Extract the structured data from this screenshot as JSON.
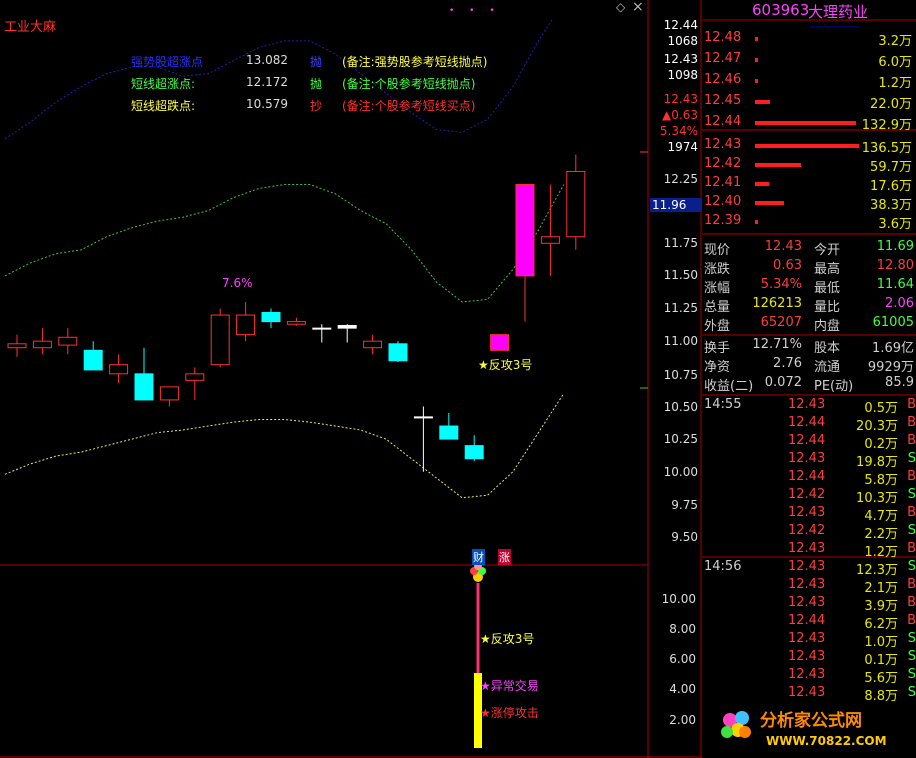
{
  "title": "工业大麻",
  "top_dots": "• • •",
  "diamond_icon": "◇",
  "close_icon": "×",
  "legend": [
    {
      "name": "强势股超涨点",
      "value": "13.082",
      "tag": "抛",
      "note": "(备注:强势股参考短线抛点)",
      "color": "#2a2aff",
      "tag_color": "#4040ff",
      "note_color": "#ffff40"
    },
    {
      "name": "短线超涨点:",
      "value": "12.172",
      "tag": "抛",
      "note": "(备注:个股参考短线抛点)",
      "color": "#40ff40",
      "tag_color": "#40ff40",
      "note_color": "#40ff40"
    },
    {
      "name": "短线超跌点:",
      "value": "10.579",
      "tag": "抄",
      "note": "(备注:个股参考短线买点)",
      "color": "#ffff40",
      "tag_color": "#ff3030",
      "note_color": "#ff3030"
    }
  ],
  "annotations": {
    "pct_label": "7.6%",
    "fangong_main": "★反攻3号",
    "cai_badge": "财",
    "zhang_badge": "涨",
    "fangong_sub": "★反攻3号",
    "yichang": "★异常交易",
    "zhangting": "★涨停攻击"
  },
  "price_axis": {
    "ticks": [
      "12.44",
      "1068",
      "12.43",
      "1098",
      "12.43",
      "▲0.63",
      "5.34%",
      "1974",
      "12.25",
      "11.96",
      "11.75",
      "11.50",
      "11.25",
      "11.00",
      "10.75",
      "10.50",
      "10.25",
      "10.00",
      "9.75",
      "9.50"
    ],
    "current": "11.96"
  },
  "sub_axis": [
    "10.00",
    "8.00",
    "6.00",
    "4.00",
    "2.00"
  ],
  "chart_data": {
    "type": "candlestick",
    "ylim": [
      9.4,
      12.55
    ],
    "candles": [
      {
        "o": 10.95,
        "h": 11.05,
        "l": 10.88,
        "c": 10.98,
        "dir": "up"
      },
      {
        "o": 10.95,
        "h": 11.1,
        "l": 10.9,
        "c": 11.0,
        "dir": "up"
      },
      {
        "o": 11.03,
        "h": 11.1,
        "l": 10.9,
        "c": 10.97,
        "dir": "up"
      },
      {
        "o": 10.93,
        "h": 11.0,
        "l": 10.78,
        "c": 10.78,
        "dir": "down"
      },
      {
        "o": 10.75,
        "h": 10.9,
        "l": 10.68,
        "c": 10.82,
        "dir": "up"
      },
      {
        "o": 10.75,
        "h": 10.95,
        "l": 10.55,
        "c": 10.55,
        "dir": "down"
      },
      {
        "o": 10.55,
        "h": 10.65,
        "l": 10.5,
        "c": 10.65,
        "dir": "up"
      },
      {
        "o": 10.7,
        "h": 10.8,
        "l": 10.55,
        "c": 10.75,
        "dir": "up"
      },
      {
        "o": 10.82,
        "h": 11.25,
        "l": 10.8,
        "c": 11.2,
        "dir": "up"
      },
      {
        "o": 11.05,
        "h": 11.3,
        "l": 11.0,
        "c": 11.2,
        "dir": "up"
      },
      {
        "o": 11.22,
        "h": 11.25,
        "l": 11.1,
        "c": 11.15,
        "dir": "down"
      },
      {
        "o": 11.15,
        "h": 11.18,
        "l": 11.12,
        "c": 11.13,
        "dir": "up"
      },
      {
        "o": 11.1,
        "h": 11.13,
        "l": 10.99,
        "c": 11.1,
        "dir": "flat"
      },
      {
        "o": 11.1,
        "h": 11.13,
        "l": 10.99,
        "c": 11.12,
        "dir": "flat"
      },
      {
        "o": 10.95,
        "h": 11.05,
        "l": 10.9,
        "c": 11.0,
        "dir": "up"
      },
      {
        "o": 10.98,
        "h": 11.0,
        "l": 10.84,
        "c": 10.85,
        "dir": "down"
      },
      {
        "o": 10.42,
        "h": 10.5,
        "l": 10.0,
        "c": 10.42,
        "dir": "flat"
      },
      {
        "o": 10.35,
        "h": 10.45,
        "l": 10.25,
        "c": 10.25,
        "dir": "down"
      },
      {
        "o": 10.2,
        "h": 10.28,
        "l": 10.08,
        "c": 10.1,
        "dir": "down"
      },
      {
        "o": 10.93,
        "h": 11.05,
        "l": 10.93,
        "c": 11.05,
        "dir": "magenta"
      },
      {
        "o": 11.5,
        "h": 12.2,
        "l": 11.15,
        "c": 12.2,
        "dir": "magenta"
      },
      {
        "o": 11.75,
        "h": 12.2,
        "l": 11.5,
        "c": 11.8,
        "dir": "up"
      },
      {
        "o": 11.8,
        "h": 12.43,
        "l": 11.7,
        "c": 12.3,
        "dir": "up"
      }
    ],
    "band_upper": [
      12.55,
      12.68,
      12.83,
      12.95,
      13.05,
      13.1,
      13.1,
      13.03,
      13.05,
      13.15,
      13.25,
      13.3,
      13.3,
      13.2,
      13.05,
      12.9,
      12.75,
      12.62,
      12.6,
      12.7,
      12.95,
      13.3,
      13.6
    ],
    "band_mid": [
      11.5,
      11.6,
      11.67,
      11.7,
      11.8,
      11.87,
      11.92,
      11.95,
      12.0,
      12.1,
      12.17,
      12.2,
      12.2,
      12.13,
      12.0,
      11.9,
      11.7,
      11.45,
      11.3,
      11.32,
      11.55,
      11.85,
      12.2
    ],
    "band_low": [
      9.98,
      10.06,
      10.12,
      10.15,
      10.2,
      10.25,
      10.3,
      10.32,
      10.35,
      10.38,
      10.4,
      10.4,
      10.38,
      10.35,
      10.32,
      10.25,
      10.1,
      9.95,
      9.8,
      9.82,
      10.0,
      10.3,
      10.6
    ],
    "sub": {
      "type": "bar",
      "ylim": [
        0,
        11.5
      ],
      "values": [
        5.0,
        11.0
      ]
    }
  },
  "quote": {
    "code": "603963",
    "name": "大理药业",
    "asks": [
      {
        "price": "12.48",
        "vol": "3.2万",
        "bar": 0.02
      },
      {
        "price": "12.47",
        "vol": "6.0万",
        "bar": 0.02
      },
      {
        "price": "12.46",
        "vol": "1.2万",
        "bar": 0.01
      },
      {
        "price": "12.45",
        "vol": "22.0万",
        "bar": 0.14
      },
      {
        "price": "12.44",
        "vol": "132.9万",
        "bar": 0.97
      }
    ],
    "bids": [
      {
        "price": "12.43",
        "vol": "136.5万",
        "bar": 1.0
      },
      {
        "price": "12.42",
        "vol": "59.7万",
        "bar": 0.44
      },
      {
        "price": "12.41",
        "vol": "17.6万",
        "bar": 0.13
      },
      {
        "price": "12.40",
        "vol": "38.3万",
        "bar": 0.28
      },
      {
        "price": "12.39",
        "vol": "3.6万",
        "bar": 0.02
      }
    ],
    "stats": [
      {
        "k": "现价",
        "v": "12.43",
        "vc": "#ff3c3c",
        "k2": "今开",
        "v2": "11.69",
        "v2c": "#40ff40"
      },
      {
        "k": "涨跌",
        "v": "0.63",
        "vc": "#ff3c3c",
        "k2": "最高",
        "v2": "12.80",
        "v2c": "#ff3c3c"
      },
      {
        "k": "涨幅",
        "v": "5.34%",
        "vc": "#ff3c3c",
        "k2": "最低",
        "v2": "11.64",
        "v2c": "#40ff40"
      },
      {
        "k": "总量",
        "v": "126213",
        "vc": "#e8e800",
        "k2": "量比",
        "v2": "2.06",
        "v2c": "#ff40ff"
      },
      {
        "k": "外盘",
        "v": "65207",
        "vc": "#ff3c3c",
        "k2": "内盘",
        "v2": "61005",
        "v2c": "#40ff40"
      }
    ],
    "stats2": [
      {
        "k": "换手",
        "v": "12.71%",
        "vc": "#cfcfcf",
        "k2": "股本",
        "v2": "1.69亿",
        "v2c": "#cfcfcf"
      },
      {
        "k": "净资",
        "v": "2.76",
        "vc": "#cfcfcf",
        "k2": "流通",
        "v2": "9929万",
        "v2c": "#cfcfcf"
      },
      {
        "k": "收益(二)",
        "v": "0.072",
        "vc": "#cfcfcf",
        "k2": "PE(动)",
        "v2": "85.9",
        "v2c": "#cfcfcf"
      }
    ],
    "ticks1": {
      "time": "14:55",
      "rows": [
        {
          "p": "12.43",
          "v": "0.5万",
          "d": "B"
        },
        {
          "p": "12.44",
          "v": "20.3万",
          "d": "B"
        },
        {
          "p": "12.44",
          "v": "0.2万",
          "d": "B"
        },
        {
          "p": "12.43",
          "v": "19.8万",
          "d": "S"
        },
        {
          "p": "12.44",
          "v": "5.8万",
          "d": "B"
        },
        {
          "p": "12.42",
          "v": "10.3万",
          "d": "S"
        },
        {
          "p": "12.43",
          "v": "4.7万",
          "d": "B"
        },
        {
          "p": "12.42",
          "v": "2.2万",
          "d": "S"
        },
        {
          "p": "12.43",
          "v": "1.2万",
          "d": "B"
        }
      ]
    },
    "ticks2": {
      "time": "14:56",
      "rows": [
        {
          "p": "12.43",
          "v": "12.3万",
          "d": "S"
        },
        {
          "p": "12.43",
          "v": "2.1万",
          "d": "B"
        },
        {
          "p": "12.43",
          "v": "3.9万",
          "d": "B"
        },
        {
          "p": "12.44",
          "v": "6.2万",
          "d": "B"
        },
        {
          "p": "12.43",
          "v": "1.0万",
          "d": "S"
        },
        {
          "p": "12.43",
          "v": "0.1万",
          "d": "S"
        },
        {
          "p": "12.43",
          "v": "5.6万",
          "d": "S"
        },
        {
          "p": "12.43",
          "v": "8.8万",
          "d": "S"
        }
      ]
    }
  },
  "watermark": {
    "line1": "分析家公式网",
    "line2": "WWW.70822.COM"
  }
}
